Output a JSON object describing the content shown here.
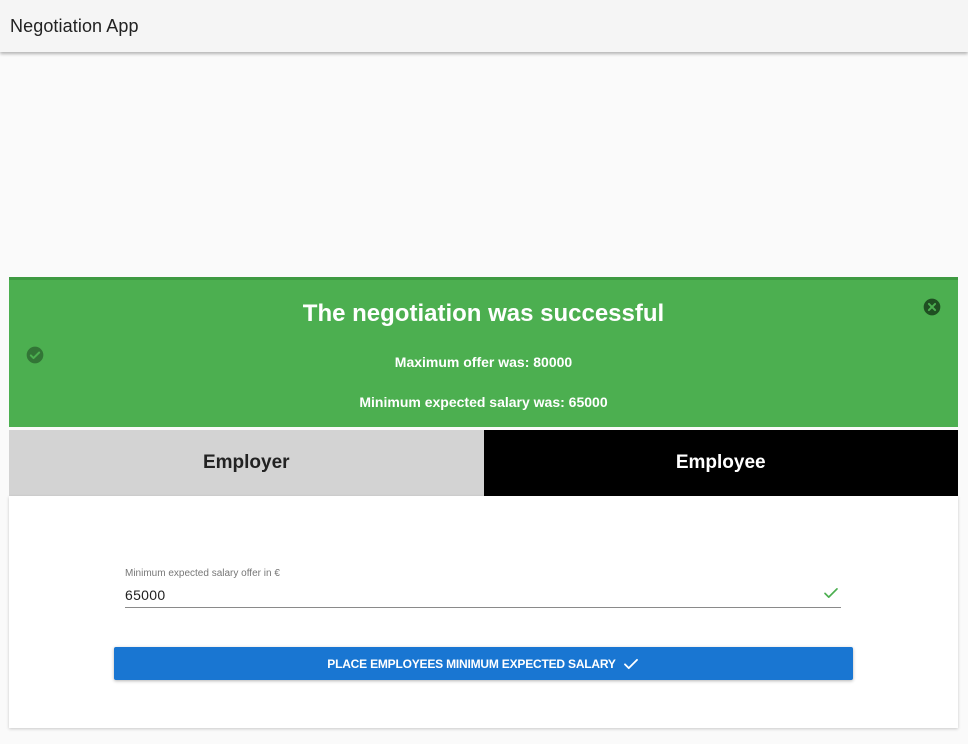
{
  "app": {
    "title": "Negotiation App"
  },
  "alert": {
    "title": "The negotiation was successful",
    "max_offer_text": "Maximum offer was: 80000",
    "min_salary_text": "Minimum expected salary was: 65000",
    "status_icon": "check-circle-icon",
    "close_icon": "close-circle-icon",
    "color": "#4caf50"
  },
  "tabs": [
    {
      "label": "Employer",
      "active": false
    },
    {
      "label": "Employee",
      "active": true
    }
  ],
  "form": {
    "field_label": "Minimum expected salary offer in €",
    "field_value": "65000",
    "valid_icon": "check-icon",
    "submit_label": "PLACE EMPLOYEES MINIMUM EXPECTED SALARY",
    "submit_icon": "check-icon",
    "submit_color": "#1976d2"
  }
}
